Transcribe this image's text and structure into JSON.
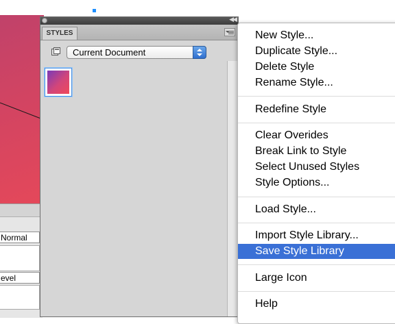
{
  "styles_panel": {
    "tab_label": "STYLES",
    "document_select": {
      "selected": "Current Document"
    },
    "icons": [
      "close-icon",
      "collapse-icon",
      "panel-menu-icon",
      "document-icon",
      "select-arrows-icon"
    ]
  },
  "properties_fragment": {
    "field_1": "Normal",
    "field_2": "evel"
  },
  "context_menu": {
    "groups": [
      [
        "New Style...",
        "Duplicate Style...",
        "Delete Style",
        "Rename Style..."
      ],
      [
        "Redefine Style"
      ],
      [
        "Clear Overides",
        "Break Link to Style",
        "Select Unused Styles",
        "Style Options..."
      ],
      [
        "Load Style..."
      ],
      [
        "Import Style Library...",
        "Save Style Library"
      ],
      [
        "Large Icon"
      ],
      [
        "Help"
      ]
    ],
    "highlighted": "Save Style Library"
  },
  "colors": {
    "menu_highlight": "#3a70d6",
    "swatch_gradient": [
      "#7a3ab8",
      "#d2467a",
      "#f0485a"
    ],
    "selection_blue": "#4a90e2"
  }
}
